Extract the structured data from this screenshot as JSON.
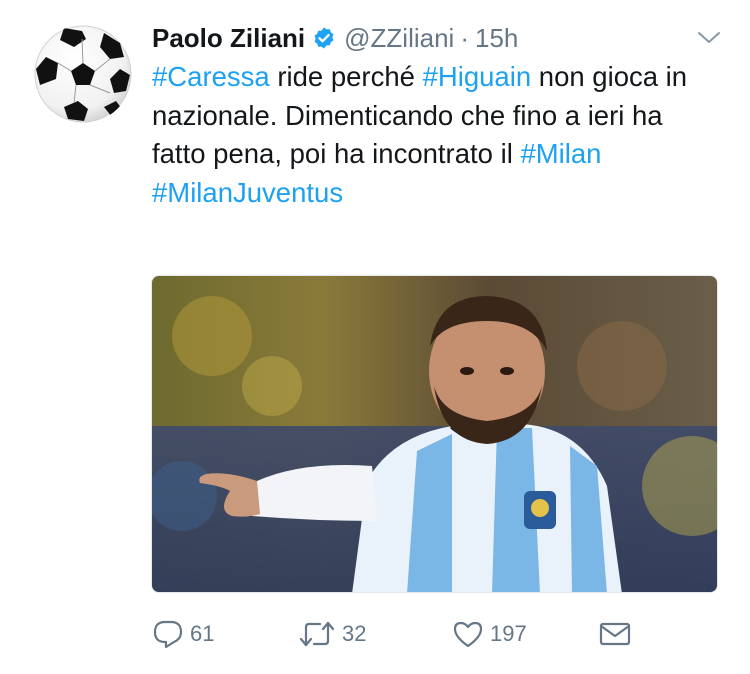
{
  "tweet": {
    "author_name": "Paolo Ziliani",
    "handle": "@ZZiliani",
    "separator": "·",
    "time": "15h",
    "segments": [
      {
        "text": "#Caressa",
        "hashtag": true
      },
      {
        "text": " ride perché ",
        "hashtag": false
      },
      {
        "text": "#Higuain",
        "hashtag": true
      },
      {
        "text": " non gioca in nazionale. Dimenticando che fino a ieri ha fatto pena, poi ha incontrato il ",
        "hashtag": false
      },
      {
        "text": "#Milan",
        "hashtag": true
      },
      {
        "text": "\n",
        "hashtag": false
      },
      {
        "text": "#MilanJuventus",
        "hashtag": true
      }
    ]
  },
  "actions": {
    "reply_count": "61",
    "retweet_count": "32",
    "like_count": "197"
  },
  "colors": {
    "hashtag": "#1da1f2",
    "muted": "#657786",
    "verified_badge": "#1da1f2"
  },
  "icons": [
    "soccer-ball-avatar",
    "verified-icon",
    "chevron-down-icon",
    "reply-icon",
    "retweet-icon",
    "like-icon",
    "direct-message-icon"
  ]
}
